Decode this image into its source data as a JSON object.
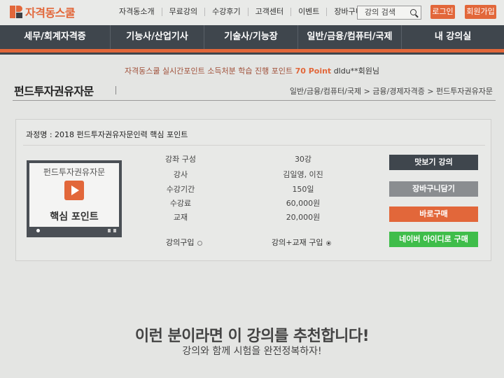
{
  "header": {
    "logo_text": "자격동스쿨",
    "nav": [
      "자격동소개",
      "무료강의",
      "수강후기",
      "고객센터",
      "이벤트",
      "장바구니"
    ],
    "search_placeholder": "강의 검색",
    "login": "로그인",
    "join": "회원가입"
  },
  "main_nav": [
    "세무/회계자격증",
    "기능사/산업기사",
    "기술사/기능장",
    "일반/금융/컴퓨터/국제",
    "내 강의실"
  ],
  "notice": {
    "prefix": "자격동스쿨 실시간포인트 소득처분 학습 진행 포인트",
    "points": "70 Point",
    "user": "dldu**회원님"
  },
  "page": {
    "title": "펀드투자권유자문",
    "breadcrumb": "일반/금융/컴퓨터/국제 > 금융/경제자격증 > 펀드투자권유자문"
  },
  "course": {
    "name": "과정명 : 2018 펀드투자권유자문인력 핵심 포인트",
    "thumb_top": "펀드투자권유자문",
    "thumb_bottom": "핵심 포인트",
    "details": [
      {
        "label": "강좌 구성",
        "value": "30강"
      },
      {
        "label": "강사",
        "value": "김일영, 이진"
      },
      {
        "label": "수강기간",
        "value": "150일"
      },
      {
        "label": "수강료",
        "value": "60,000원"
      },
      {
        "label": "교재",
        "value": "20,000원"
      }
    ],
    "option_lecture": "강의구입",
    "option_bundle": "강의+교재 구입",
    "selected_option": "강의+교재 구입"
  },
  "buttons": {
    "preview": "맛보기 강의",
    "cart": "장바구니담기",
    "buy": "바로구매",
    "naver": "네이버 아이디로 구매"
  },
  "recommend": {
    "title": "이런 분이라면 이 강의를 추천합니다!",
    "subtitle": "강의와 함께 시험을 완전정복하자!"
  }
}
